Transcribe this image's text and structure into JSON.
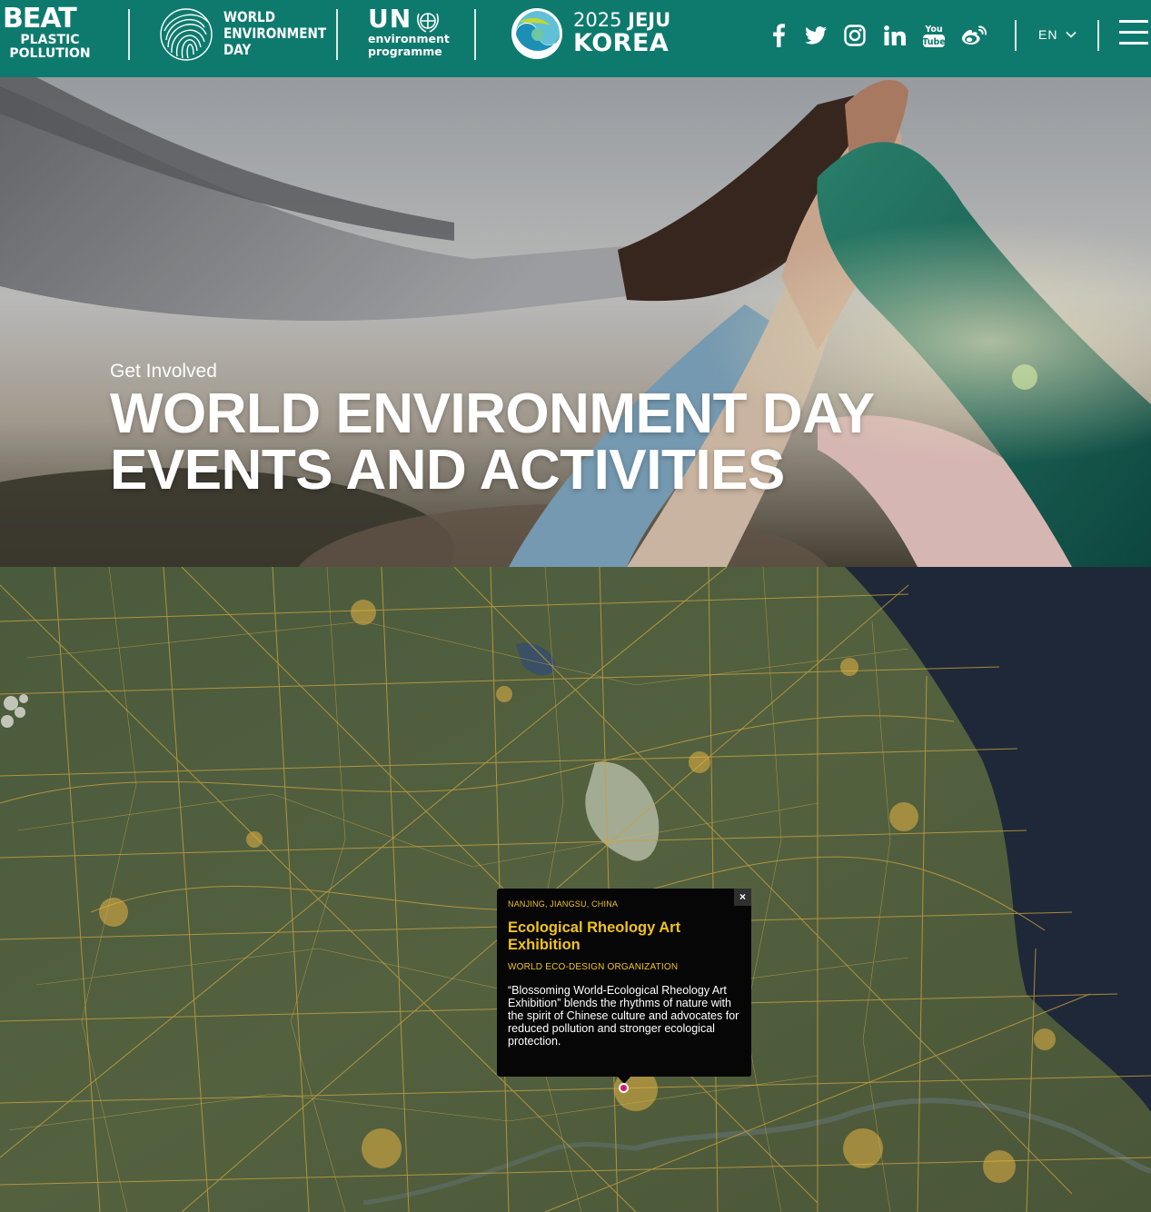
{
  "header": {
    "beat_logo": {
      "line1": "BEAT",
      "line2": "PLASTIC",
      "line3": "POLLUTION"
    },
    "wed_logo": {
      "line1": "WORLD",
      "line2": "ENVIRONMENT",
      "line3": "DAY"
    },
    "un_logo": {
      "title": "UN",
      "line1": "environment",
      "line2": "programme"
    },
    "host_logo": {
      "year": "2025",
      "city": "JEJU",
      "country": "KOREA"
    },
    "social_links": [
      {
        "icon": "facebook-icon"
      },
      {
        "icon": "twitter-icon"
      },
      {
        "icon": "instagram-icon"
      },
      {
        "icon": "linkedin-icon"
      },
      {
        "icon": "youtube-icon",
        "text_top": "You",
        "text_bottom": "Tube"
      },
      {
        "icon": "weibo-icon"
      }
    ],
    "language": "EN",
    "background_color": "#0e7a6e"
  },
  "hero": {
    "kicker": "Get Involved",
    "title_line1": "WORLD ENVIRONMENT DAY",
    "title_line2": "EVENTS AND ACTIVITIES"
  },
  "map": {
    "popup": {
      "location": "NANJING, JIANGSU, CHINA",
      "title": "Ecological Rheology Art Exhibition",
      "organizer": "WORLD ECO-DESIGN ORGANIZATION",
      "description": "“Blossoming World-Ecological Rheology Art Exhibition” blends the rhythms of nature with the spirit of Chinese culture and advocates for reduced pollution and stronger ecological protection.",
      "close_label": "×",
      "accent_color": "#f2c31e"
    },
    "marker_color": "#d6196b"
  }
}
